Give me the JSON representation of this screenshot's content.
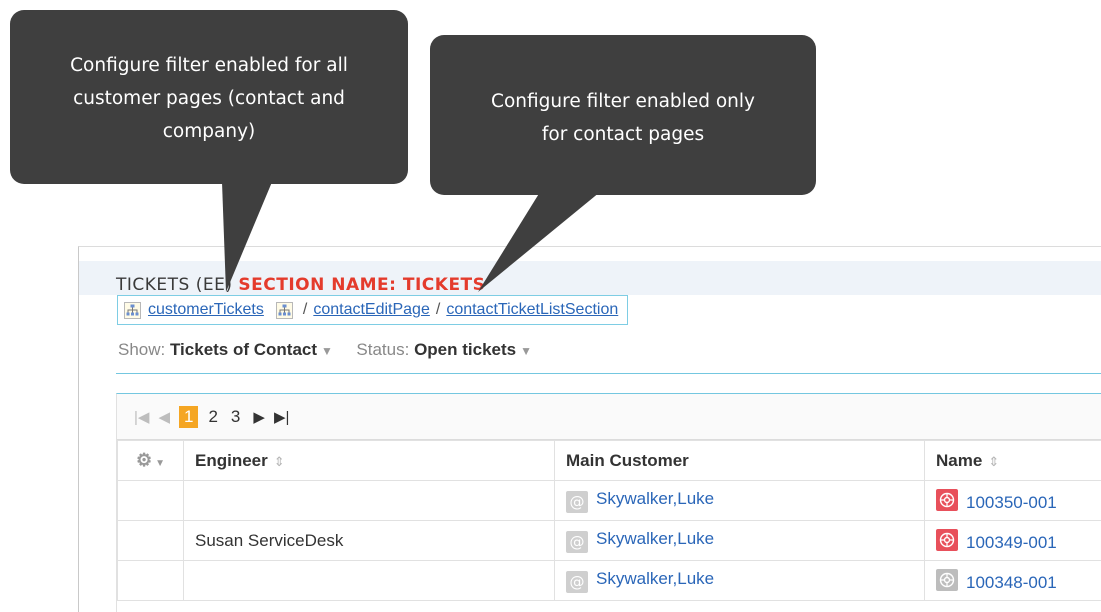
{
  "callouts": [
    {
      "line1": "Configure filter enabled for all",
      "line2": "customer pages (contact and",
      "line3": "company)"
    },
    {
      "line1": "Configure filter enabled only",
      "line2": "for contact pages"
    }
  ],
  "section": {
    "prefix": "TICKETS (EE)",
    "label": "SECTION NAME: TICKETS"
  },
  "config_bar": {
    "filter_link": "customerTickets",
    "separator": "/",
    "page_link": "contactEditPage",
    "section_link": "contactTicketListSection"
  },
  "filters": {
    "show_label": "Show:",
    "show_value": "Tickets of Contact",
    "status_label": "Status:",
    "status_value": "Open tickets"
  },
  "pager": {
    "first_icon": "first-page-icon",
    "prev_icon": "previous-page-icon",
    "pages": [
      "1",
      "2",
      "3"
    ],
    "active_page": "1",
    "next_icon": "next-page-icon",
    "last_icon": "last-page-icon"
  },
  "table": {
    "columns": [
      "Engineer",
      "Main Customer",
      "Name"
    ],
    "rows": [
      {
        "engineer": "",
        "customer": "Skywalker,Luke",
        "name": "100350-001",
        "status_color": "#e8505b"
      },
      {
        "engineer": "Susan ServiceDesk",
        "customer": "Skywalker,Luke",
        "name": "100349-001",
        "status_color": "#e8505b"
      },
      {
        "engineer": "",
        "customer": "Skywalker,Luke",
        "name": "100348-001",
        "status_color": "#bdbdbd"
      }
    ]
  },
  "colors": {
    "callout_bg": "#3f3f3f",
    "accent_red": "#e43b2c",
    "link_blue": "#2a66b8",
    "pager_active": "#f5a623",
    "rule_blue": "#74c7e0"
  }
}
